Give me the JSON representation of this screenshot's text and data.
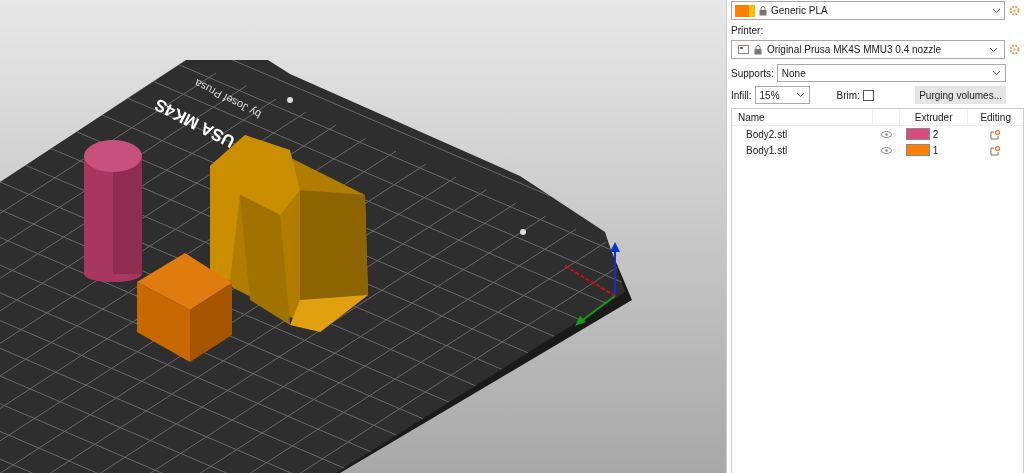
{
  "viewport": {
    "bed_texts": [
      "USA MK4S",
      "by Josef Prusa"
    ]
  },
  "filament": {
    "value": "Generic PLA",
    "swatches": [
      {
        "color": "#ff8000"
      },
      {
        "color": "#f5c400"
      }
    ]
  },
  "printer": {
    "label": "Printer:",
    "value": "Original Prusa MK4S MMU3 0.4 nozzle"
  },
  "supports": {
    "label": "Supports:",
    "value": "None"
  },
  "infill": {
    "label": "Infill:",
    "value": "15%"
  },
  "brim": {
    "label": "Brim:",
    "checked": false
  },
  "purging_button": "Purging volumes...",
  "object_list": {
    "columns": [
      "Name",
      "Extruder",
      "Editing"
    ],
    "rows": [
      {
        "name": "Body2.stl",
        "color": "#d84b7d",
        "extruder": "2"
      },
      {
        "name": "Body1.stl",
        "color": "#ff8000",
        "extruder": "1"
      }
    ]
  }
}
